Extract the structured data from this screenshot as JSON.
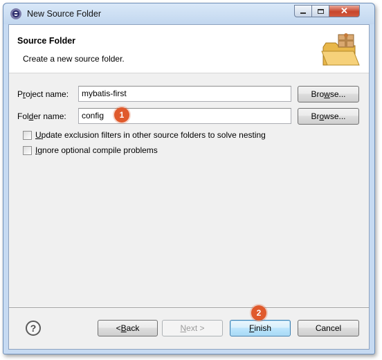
{
  "window": {
    "title": "New Source Folder",
    "close_glyph": "✕"
  },
  "header": {
    "title": "Source Folder",
    "description": "Create a new source folder."
  },
  "project": {
    "label_pre": "P",
    "label_accel": "r",
    "label_post": "oject name:",
    "value": "mybatis-first",
    "browse_pre": "Bro",
    "browse_accel": "w",
    "browse_post": "se..."
  },
  "folder": {
    "label_pre": "Fol",
    "label_accel": "d",
    "label_post": "er name:",
    "value": "config",
    "browse_pre": "Br",
    "browse_accel": "o",
    "browse_post": "wse..."
  },
  "options": {
    "update_exclusion_accel": "U",
    "update_exclusion_rest": "pdate exclusion filters in other source folders to solve nesting",
    "ignore_optional_accel": "I",
    "ignore_optional_rest": "gnore optional compile problems",
    "update_exclusion_checked": false,
    "ignore_optional_checked": false
  },
  "annotations": {
    "step1": "1",
    "step2": "2",
    "badge_color": "#e05a2c"
  },
  "footer": {
    "help": "?",
    "back_pre": "< ",
    "back_accel": "B",
    "back_post": "ack",
    "next_pre": "",
    "next_accel": "N",
    "next_post": "ext >",
    "finish_accel": "F",
    "finish_post": "inish",
    "cancel": "Cancel"
  },
  "icons": [
    "app-icon",
    "folder-box-icon",
    "help-icon",
    "minimize-icon",
    "maximize-icon",
    "close-icon"
  ]
}
